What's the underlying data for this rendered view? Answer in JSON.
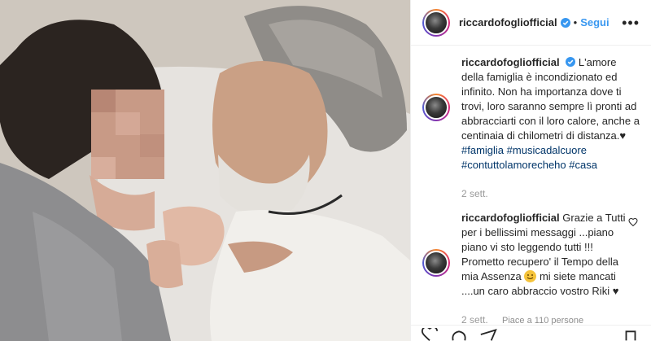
{
  "post": {
    "username": "riccardofogliofficial",
    "separator": "•",
    "follow_label": "Segui",
    "more_label": "•••"
  },
  "caption": {
    "username": "riccardofogliofficial",
    "text": "L'amore della famiglia è incondizionato ed infinito. Non ha importanza dove ti trovi, loro saranno sempre lì pronti ad abbracciarti con il loro calore, anche a centinaia di chilometri di distanza.♥",
    "hashtags": [
      "#famiglia",
      "#musicadalcuore",
      "#contuttolamorecheho",
      "#casa"
    ],
    "time": "2 sett."
  },
  "reply": {
    "username": "riccardofogliofficial",
    "text_before_emoji": "Grazie a Tutti per i bellissimi messaggi ...piano piano vi sto leggendo tutti !!! Prometto recupero' il Tempo della mia Assenza",
    "text_after_emoji": "mi siete mancati ....un caro abbraccio vostro Riki ♥",
    "time": "2 sett.",
    "likes": "Piace a 110 persone"
  },
  "colors": {
    "link": "#3897f0",
    "hashtag": "#003569",
    "muted": "#999999",
    "verified": "#3897f0"
  },
  "icons": [
    "verified-badge-icon",
    "heart-icon",
    "comment-icon",
    "share-icon",
    "bookmark-icon",
    "smiley-emoji-icon"
  ]
}
